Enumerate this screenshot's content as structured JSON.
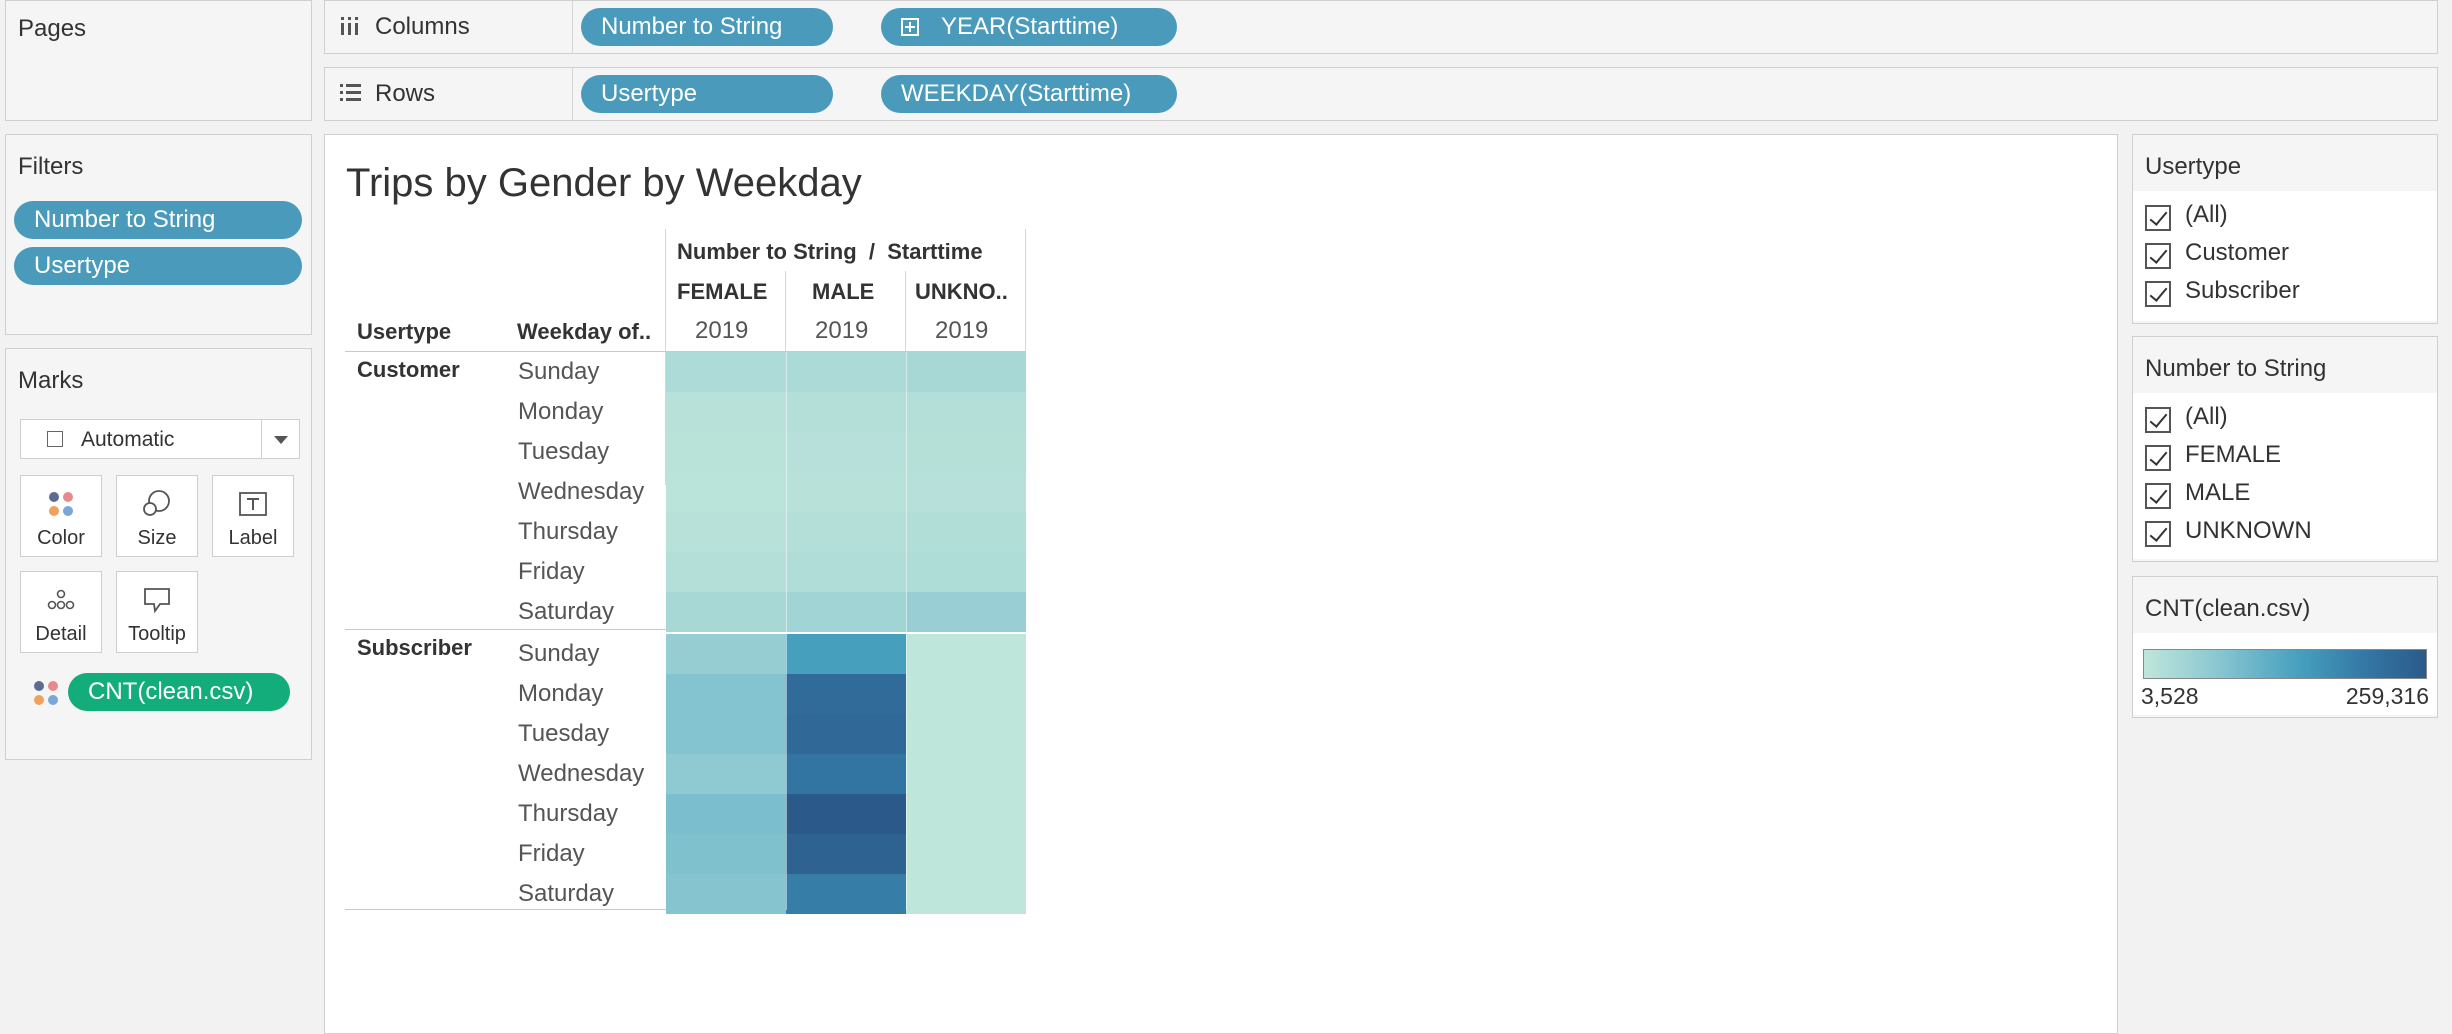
{
  "pages": {
    "title": "Pages"
  },
  "columns_shelf": {
    "label": "Columns",
    "pills": [
      "Number to String",
      "YEAR(Starttime)"
    ]
  },
  "rows_shelf": {
    "label": "Rows",
    "pills": [
      "Usertype",
      "WEEKDAY(Starttime)"
    ]
  },
  "filters": {
    "title": "Filters",
    "pills": [
      "Number to String",
      "Usertype"
    ]
  },
  "marks": {
    "title": "Marks",
    "mark_type": "Automatic",
    "buttons": [
      "Color",
      "Size",
      "Label",
      "Detail",
      "Tooltip"
    ],
    "color_pill": "CNT(clean.csv)"
  },
  "view": {
    "title": "Trips by Gender by Weekday",
    "col_header_top": "Number to String  /  Starttime",
    "row_headers": [
      "Usertype",
      "Weekday of.."
    ],
    "col_groups": [
      "FEMALE",
      "MALE",
      "UNKNO.."
    ],
    "col_years": [
      "2019",
      "2019",
      "2019"
    ],
    "usertypes": [
      "Customer",
      "Subscriber"
    ],
    "weekdays": [
      "Sunday",
      "Monday",
      "Tuesday",
      "Wednesday",
      "Thursday",
      "Friday",
      "Saturday"
    ]
  },
  "legend_usertype": {
    "title": "Usertype",
    "items": [
      "(All)",
      "Customer",
      "Subscriber"
    ]
  },
  "legend_gender": {
    "title": "Number to String",
    "items": [
      "(All)",
      "FEMALE",
      "MALE",
      "UNKNOWN"
    ]
  },
  "color_legend": {
    "title": "CNT(clean.csv)",
    "min": "3,528",
    "max": "259,316",
    "color_low": "#bfe6da",
    "color_high": "#2b5a8a"
  },
  "chart_data": {
    "type": "heatmap",
    "title": "Trips by Gender by Weekday",
    "measure": "CNT(clean.csv)",
    "columns": [
      "FEMALE",
      "MALE",
      "UNKNO.."
    ],
    "rows": [
      {
        "usertype": "Customer",
        "weekday": "Sunday",
        "values": [
          22000,
          24000,
          28000
        ]
      },
      {
        "usertype": "Customer",
        "weekday": "Monday",
        "values": [
          12000,
          15000,
          16000
        ]
      },
      {
        "usertype": "Customer",
        "weekday": "Tuesday",
        "values": [
          10000,
          13000,
          14000
        ]
      },
      {
        "usertype": "Customer",
        "weekday": "Wednesday",
        "values": [
          9000,
          12000,
          13000
        ]
      },
      {
        "usertype": "Customer",
        "weekday": "Thursday",
        "values": [
          12000,
          15000,
          17000
        ]
      },
      {
        "usertype": "Customer",
        "weekday": "Friday",
        "values": [
          15000,
          19000,
          21000
        ]
      },
      {
        "usertype": "Customer",
        "weekday": "Saturday",
        "values": [
          28000,
          34000,
          42000
        ]
      },
      {
        "usertype": "Subscriber",
        "weekday": "Sunday",
        "values": [
          46000,
          120000,
          3528
        ]
      },
      {
        "usertype": "Subscriber",
        "weekday": "Monday",
        "values": [
          62000,
          215000,
          3600
        ]
      },
      {
        "usertype": "Subscriber",
        "weekday": "Tuesday",
        "values": [
          62000,
          220000,
          3600
        ]
      },
      {
        "usertype": "Subscriber",
        "weekday": "Wednesday",
        "values": [
          52000,
          190000,
          3600
        ]
      },
      {
        "usertype": "Subscriber",
        "weekday": "Thursday",
        "values": [
          70000,
          259316,
          3700
        ]
      },
      {
        "usertype": "Subscriber",
        "weekday": "Friday",
        "values": [
          66000,
          240000,
          3700
        ]
      },
      {
        "usertype": "Subscriber",
        "weekday": "Saturday",
        "values": [
          60000,
          175000,
          3600
        ]
      }
    ],
    "color_range": [
      3528,
      259316
    ]
  }
}
